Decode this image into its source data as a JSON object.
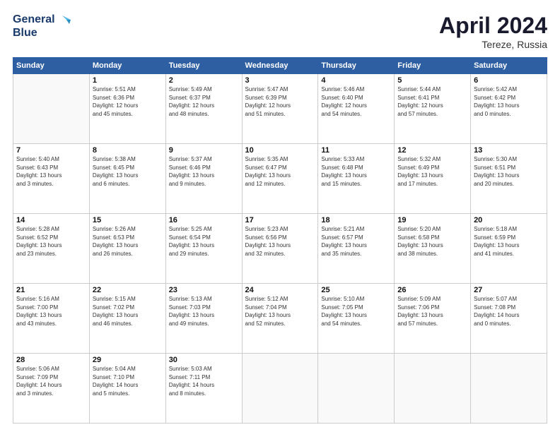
{
  "header": {
    "logo_line1": "General",
    "logo_line2": "Blue",
    "month": "April 2024",
    "location": "Tereze, Russia"
  },
  "weekdays": [
    "Sunday",
    "Monday",
    "Tuesday",
    "Wednesday",
    "Thursday",
    "Friday",
    "Saturday"
  ],
  "weeks": [
    [
      {
        "day": "",
        "info": ""
      },
      {
        "day": "1",
        "info": "Sunrise: 5:51 AM\nSunset: 6:36 PM\nDaylight: 12 hours\nand 45 minutes."
      },
      {
        "day": "2",
        "info": "Sunrise: 5:49 AM\nSunset: 6:37 PM\nDaylight: 12 hours\nand 48 minutes."
      },
      {
        "day": "3",
        "info": "Sunrise: 5:47 AM\nSunset: 6:39 PM\nDaylight: 12 hours\nand 51 minutes."
      },
      {
        "day": "4",
        "info": "Sunrise: 5:46 AM\nSunset: 6:40 PM\nDaylight: 12 hours\nand 54 minutes."
      },
      {
        "day": "5",
        "info": "Sunrise: 5:44 AM\nSunset: 6:41 PM\nDaylight: 12 hours\nand 57 minutes."
      },
      {
        "day": "6",
        "info": "Sunrise: 5:42 AM\nSunset: 6:42 PM\nDaylight: 13 hours\nand 0 minutes."
      }
    ],
    [
      {
        "day": "7",
        "info": "Sunrise: 5:40 AM\nSunset: 6:43 PM\nDaylight: 13 hours\nand 3 minutes."
      },
      {
        "day": "8",
        "info": "Sunrise: 5:38 AM\nSunset: 6:45 PM\nDaylight: 13 hours\nand 6 minutes."
      },
      {
        "day": "9",
        "info": "Sunrise: 5:37 AM\nSunset: 6:46 PM\nDaylight: 13 hours\nand 9 minutes."
      },
      {
        "day": "10",
        "info": "Sunrise: 5:35 AM\nSunset: 6:47 PM\nDaylight: 13 hours\nand 12 minutes."
      },
      {
        "day": "11",
        "info": "Sunrise: 5:33 AM\nSunset: 6:48 PM\nDaylight: 13 hours\nand 15 minutes."
      },
      {
        "day": "12",
        "info": "Sunrise: 5:32 AM\nSunset: 6:49 PM\nDaylight: 13 hours\nand 17 minutes."
      },
      {
        "day": "13",
        "info": "Sunrise: 5:30 AM\nSunset: 6:51 PM\nDaylight: 13 hours\nand 20 minutes."
      }
    ],
    [
      {
        "day": "14",
        "info": "Sunrise: 5:28 AM\nSunset: 6:52 PM\nDaylight: 13 hours\nand 23 minutes."
      },
      {
        "day": "15",
        "info": "Sunrise: 5:26 AM\nSunset: 6:53 PM\nDaylight: 13 hours\nand 26 minutes."
      },
      {
        "day": "16",
        "info": "Sunrise: 5:25 AM\nSunset: 6:54 PM\nDaylight: 13 hours\nand 29 minutes."
      },
      {
        "day": "17",
        "info": "Sunrise: 5:23 AM\nSunset: 6:56 PM\nDaylight: 13 hours\nand 32 minutes."
      },
      {
        "day": "18",
        "info": "Sunrise: 5:21 AM\nSunset: 6:57 PM\nDaylight: 13 hours\nand 35 minutes."
      },
      {
        "day": "19",
        "info": "Sunrise: 5:20 AM\nSunset: 6:58 PM\nDaylight: 13 hours\nand 38 minutes."
      },
      {
        "day": "20",
        "info": "Sunrise: 5:18 AM\nSunset: 6:59 PM\nDaylight: 13 hours\nand 41 minutes."
      }
    ],
    [
      {
        "day": "21",
        "info": "Sunrise: 5:16 AM\nSunset: 7:00 PM\nDaylight: 13 hours\nand 43 minutes."
      },
      {
        "day": "22",
        "info": "Sunrise: 5:15 AM\nSunset: 7:02 PM\nDaylight: 13 hours\nand 46 minutes."
      },
      {
        "day": "23",
        "info": "Sunrise: 5:13 AM\nSunset: 7:03 PM\nDaylight: 13 hours\nand 49 minutes."
      },
      {
        "day": "24",
        "info": "Sunrise: 5:12 AM\nSunset: 7:04 PM\nDaylight: 13 hours\nand 52 minutes."
      },
      {
        "day": "25",
        "info": "Sunrise: 5:10 AM\nSunset: 7:05 PM\nDaylight: 13 hours\nand 54 minutes."
      },
      {
        "day": "26",
        "info": "Sunrise: 5:09 AM\nSunset: 7:06 PM\nDaylight: 13 hours\nand 57 minutes."
      },
      {
        "day": "27",
        "info": "Sunrise: 5:07 AM\nSunset: 7:08 PM\nDaylight: 14 hours\nand 0 minutes."
      }
    ],
    [
      {
        "day": "28",
        "info": "Sunrise: 5:06 AM\nSunset: 7:09 PM\nDaylight: 14 hours\nand 3 minutes."
      },
      {
        "day": "29",
        "info": "Sunrise: 5:04 AM\nSunset: 7:10 PM\nDaylight: 14 hours\nand 5 minutes."
      },
      {
        "day": "30",
        "info": "Sunrise: 5:03 AM\nSunset: 7:11 PM\nDaylight: 14 hours\nand 8 minutes."
      },
      {
        "day": "",
        "info": ""
      },
      {
        "day": "",
        "info": ""
      },
      {
        "day": "",
        "info": ""
      },
      {
        "day": "",
        "info": ""
      }
    ]
  ]
}
